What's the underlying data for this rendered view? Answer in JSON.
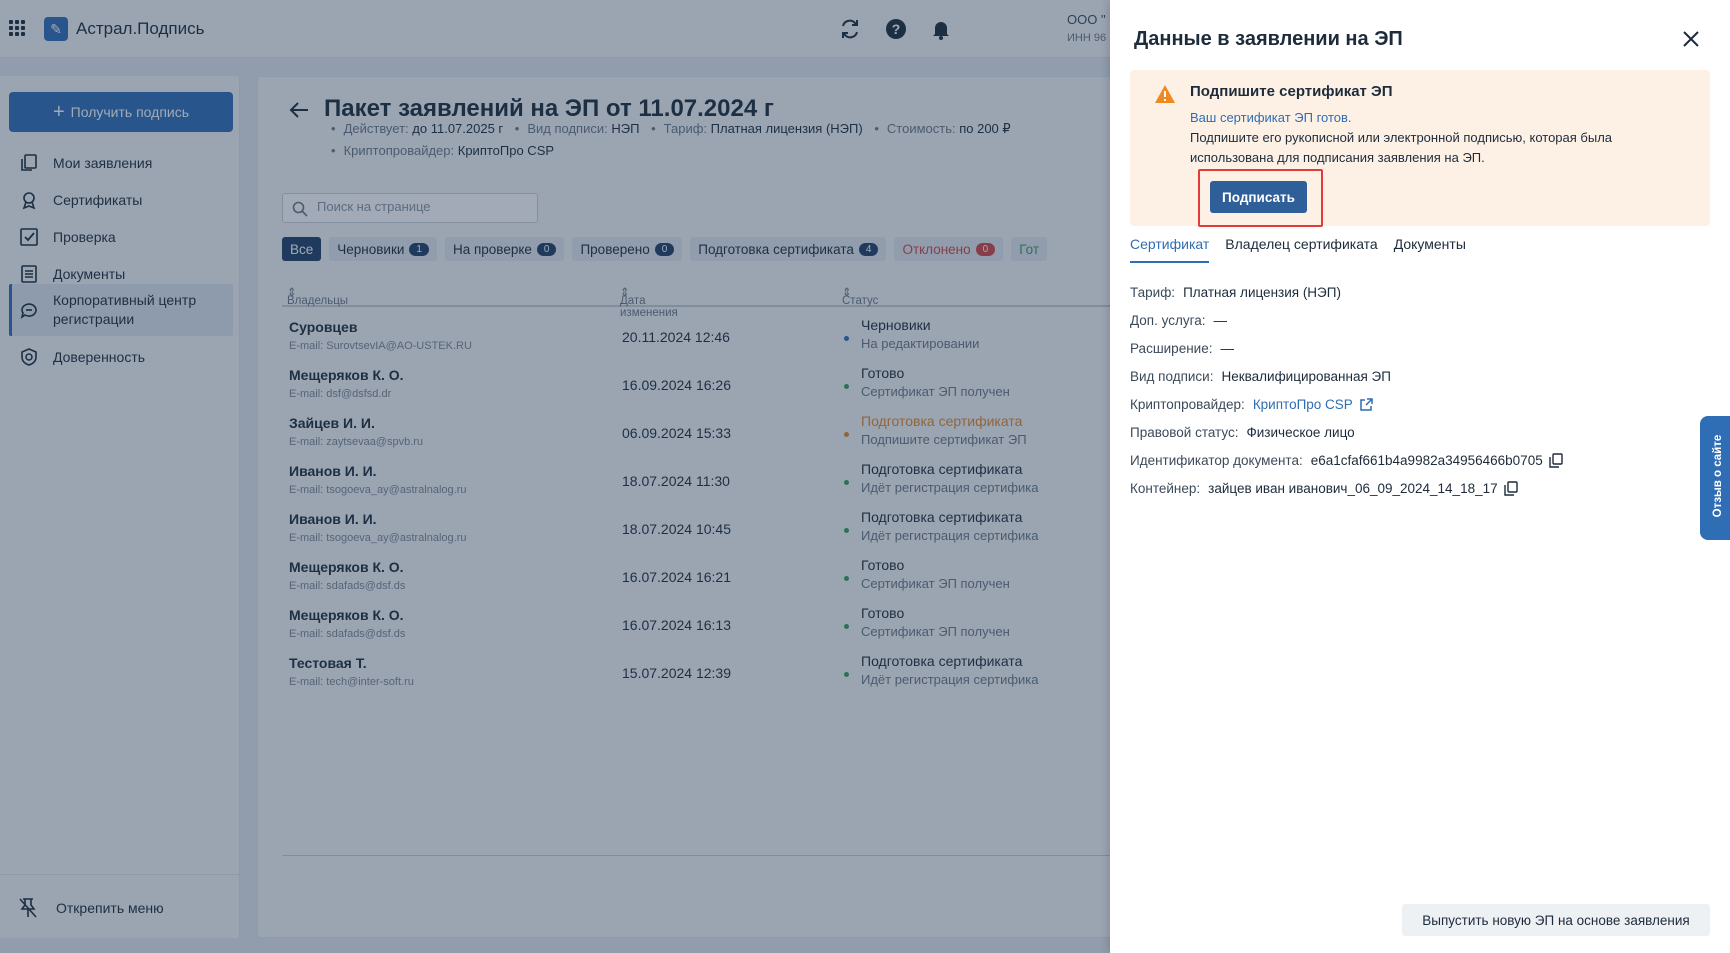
{
  "header": {
    "app_name": "Астрал.Подпись",
    "org_name": "ООО \"",
    "org_inn": "ИНН 96"
  },
  "sidebar": {
    "get_sign_label": "Получить подпись",
    "items": [
      {
        "label": "Мои заявления",
        "icon": "copy-icon"
      },
      {
        "label": "Сертификаты",
        "icon": "certificate-icon"
      },
      {
        "label": "Проверка",
        "icon": "check-icon"
      },
      {
        "label": "Документы",
        "icon": "document-icon"
      },
      {
        "label": "Корпоративный центр регистрации",
        "icon": "chat-icon",
        "active": true
      },
      {
        "label": "Доверенность",
        "icon": "shield-icon"
      }
    ],
    "unpin_label": "Открепить меню"
  },
  "main": {
    "title": "Пакет заявлений на ЭП от 11.07.2024 г",
    "meta": {
      "valid_key": "Действует:",
      "valid_value": "до 11.07.2025 г",
      "sign_type_key": "Вид подписи:",
      "sign_type_value": "НЭП",
      "tariff_key": "Тариф:",
      "tariff_value": "Платная лицензия (НЭП)",
      "cost_key": "Стоимость:",
      "cost_value": "по 200 ₽",
      "crypto_key": "Криптопровайдер:",
      "crypto_value": "КриптоПро CSP"
    },
    "search_placeholder": "Поиск на странице",
    "filters": [
      {
        "label": "Все",
        "count": null,
        "kind": "active"
      },
      {
        "label": "Черновики",
        "count": "1",
        "kind": "normal"
      },
      {
        "label": "На проверке",
        "count": "0",
        "kind": "normal"
      },
      {
        "label": "Проверено",
        "count": "0",
        "kind": "normal"
      },
      {
        "label": "Подготовка сертификата",
        "count": "4",
        "kind": "normal"
      },
      {
        "label": "Отклонено",
        "count": "0",
        "kind": "rejected"
      },
      {
        "label": "Гот",
        "count": null,
        "kind": "ready"
      }
    ],
    "columns": {
      "owners": "Владельцы",
      "date": "Дата изменения",
      "status": "Статус"
    },
    "rows": [
      {
        "owner": "Суровцев",
        "email": "E-mail: SurovtsevIA@AO-USTEK.RU",
        "date": "20.11.2024 12:46",
        "status": "Черновики",
        "substatus": "На редактировании",
        "dot": "#2f6db5",
        "color": "#1d2b3a"
      },
      {
        "owner": "Мещеряков К. О.",
        "email": "E-mail: dsf@dsfsd.dr",
        "date": "16.09.2024 16:26",
        "status": "Готово",
        "substatus": "Сертификат ЭП получен",
        "dot": "#3a9b5c",
        "color": "#1d2b3a"
      },
      {
        "owner": "Зайцев И. И.",
        "email": "E-mail: zaytsevaa@spvb.ru",
        "date": "06.09.2024 15:33",
        "status": "Подготовка сертификата",
        "substatus": "Подпишите сертификат ЭП",
        "dot": "#e08a2e",
        "color": "#e08a2e"
      },
      {
        "owner": "Иванов И. И.",
        "email": "E-mail: tsogoeva_ay@astralnalog.ru",
        "date": "18.07.2024 11:30",
        "status": "Подготовка сертификата",
        "substatus": "Идёт регистрация сертифика",
        "dot": "#3a9b5c",
        "color": "#1d2b3a"
      },
      {
        "owner": "Иванов И. И.",
        "email": "E-mail: tsogoeva_ay@astralnalog.ru",
        "date": "18.07.2024 10:45",
        "status": "Подготовка сертификата",
        "substatus": "Идёт регистрация сертифика",
        "dot": "#3a9b5c",
        "color": "#1d2b3a"
      },
      {
        "owner": "Мещеряков К. О.",
        "email": "E-mail: sdafads@dsf.ds",
        "date": "16.07.2024 16:21",
        "status": "Готово",
        "substatus": "Сертификат ЭП получен",
        "dot": "#3a9b5c",
        "color": "#1d2b3a"
      },
      {
        "owner": "Мещеряков К. О.",
        "email": "E-mail: sdafads@dsf.ds",
        "date": "16.07.2024 16:13",
        "status": "Готово",
        "substatus": "Сертификат ЭП получен",
        "dot": "#3a9b5c",
        "color": "#1d2b3a"
      },
      {
        "owner": "Тестовая Т.",
        "email": "E-mail: tech@inter-soft.ru",
        "date": "15.07.2024 12:39",
        "status": "Подготовка сертификата",
        "substatus": "Идёт регистрация сертифика",
        "dot": "#3a9b5c",
        "color": "#1d2b3a"
      }
    ]
  },
  "drawer": {
    "title": "Данные в заявлении на ЭП",
    "alert": {
      "title": "Подпишите сертификат ЭП",
      "line1": "Ваш сертификат ЭП готов.",
      "line2": "Подпишите его рукописной или электронной подписью, которая была использована для подписания заявления на ЭП.",
      "sign_label": "Подписать"
    },
    "tabs": [
      "Сертификат",
      "Владелец сертификата",
      "Документы"
    ],
    "fields": {
      "tariff_key": "Тариф:",
      "tariff_value": "Платная лицензия (НЭП)",
      "extra_key": "Доп. услуга:",
      "extra_value": "—",
      "ext_key": "Расширение:",
      "ext_value": "—",
      "sign_type_key": "Вид подписи:",
      "sign_type_value": "Неквалифицированная ЭП",
      "crypto_key": "Криптопровайдер:",
      "crypto_value": "КриптоПро CSP",
      "legal_key": "Правовой статус:",
      "legal_value": "Физическое лицо",
      "doc_id_key": "Идентификатор документа:",
      "doc_id_value": "e6a1cfaf661b4a9982a34956466b0705",
      "container_key": "Контейнер:",
      "container_value": "зайцев иван иванович_06_09_2024_14_18_17"
    },
    "issue_label": "Выпустить новую ЭП на основе заявления"
  },
  "feedback_label": "Отзыв о сайте"
}
